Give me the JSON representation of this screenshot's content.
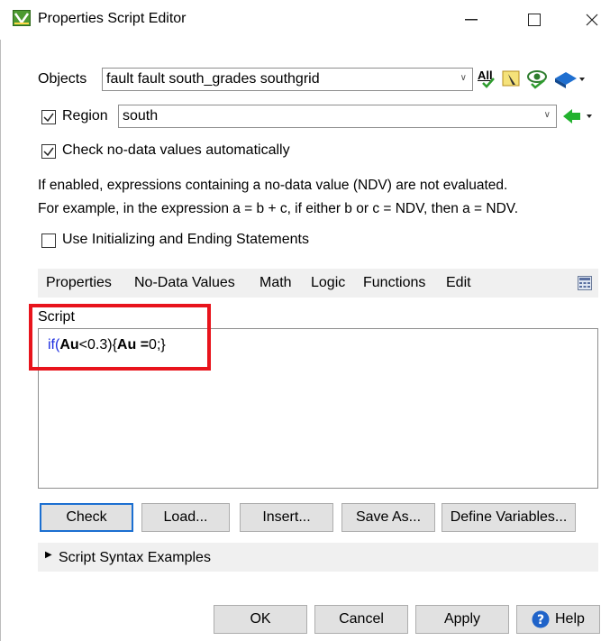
{
  "window": {
    "title": "Properties Script Editor",
    "minimize_glyph": "—",
    "maximize_glyph": "☐",
    "close_glyph": "✕"
  },
  "objects": {
    "label": "Objects",
    "value": "fault fault south_grades southgrid",
    "all_icon_text": "All"
  },
  "region": {
    "checked": true,
    "label": "Region",
    "value": "south"
  },
  "check_ndv": {
    "checked": true,
    "label": "Check no-data values automatically"
  },
  "info": {
    "line1": "If enabled, expressions containing a no-data value (NDV) are not evaluated.",
    "line2": "For example, in the expression a = b + c, if either b or c = NDV, then a = NDV."
  },
  "init_statements": {
    "checked": false,
    "label": "Use Initializing and Ending Statements"
  },
  "menu": {
    "items": [
      "Properties",
      "No-Data Values",
      "Math",
      "Logic",
      "Functions",
      "Edit"
    ]
  },
  "script": {
    "label": "Script",
    "code": {
      "kw_if": "if(",
      "var1": "Au",
      "cond": "<0.3){",
      "var2": "Au",
      "assign": " =",
      "rest": "0;}"
    }
  },
  "buttons": {
    "check": "Check",
    "load": "Load...",
    "insert": "Insert...",
    "save_as": "Save As...",
    "define_variables": "Define Variables..."
  },
  "examples": {
    "label": "Script Syntax Examples"
  },
  "footer": {
    "ok": "OK",
    "cancel": "Cancel",
    "apply": "Apply",
    "help": "Help"
  },
  "colors": {
    "highlight_box": "#e8141c",
    "default_button_border": "#1b6fd1",
    "keyword": "#1c2de0"
  }
}
